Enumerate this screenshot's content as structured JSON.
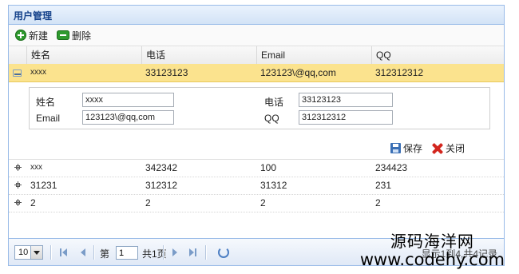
{
  "panel": {
    "title": "用户管理"
  },
  "toolbar": {
    "new_label": "新建",
    "delete_label": "删除"
  },
  "columns": [
    "姓名",
    "电话",
    "Email",
    "QQ"
  ],
  "selected_row": [
    "xxxx",
    "33123123",
    "123123\\@qq,com",
    "312312312"
  ],
  "detail": {
    "name_label": "姓名",
    "name_value": "xxxx",
    "phone_label": "电话",
    "phone_value": "33123123",
    "email_label": "Email",
    "email_value": "123123\\@qq,com",
    "qq_label": "QQ",
    "qq_value": "312312312",
    "save_label": "保存",
    "close_label": "关闭"
  },
  "rows": [
    [
      "xxx",
      "342342",
      "100",
      "234423"
    ],
    [
      "31231",
      "312312",
      "31312",
      "231"
    ],
    [
      "2",
      "2",
      "2",
      "2"
    ]
  ],
  "pager": {
    "page_size": "10",
    "page_prefix": "第",
    "page_value": "1",
    "page_total": "共1页",
    "info": "显示1到4,共4记录"
  },
  "watermark": {
    "cn": "源码海洋网",
    "url": "www.codehy.com"
  }
}
